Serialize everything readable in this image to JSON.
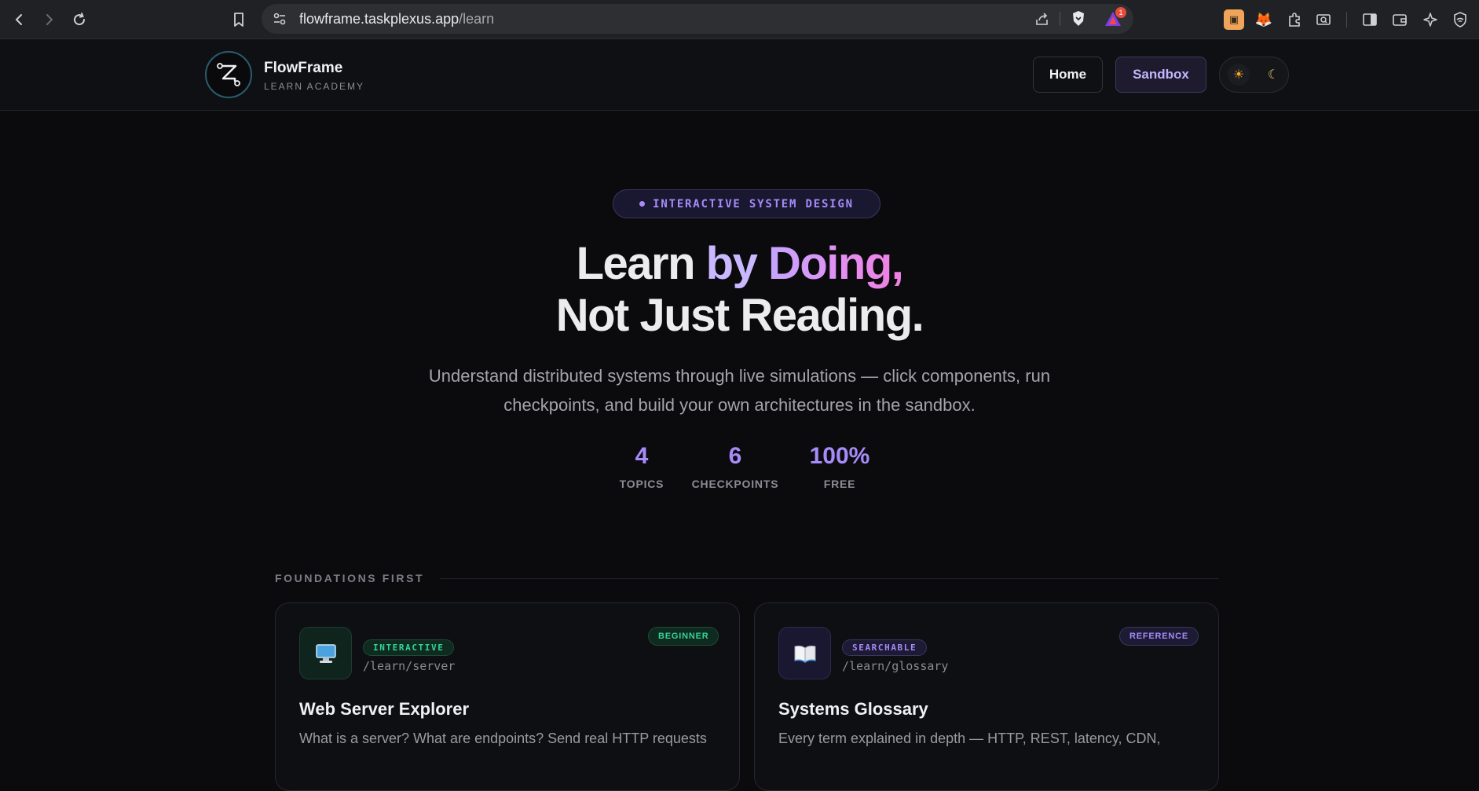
{
  "browser": {
    "url_host": "flowframe.taskplexus.app",
    "url_path": "/learn",
    "notification_count": "1"
  },
  "header": {
    "brand_name": "FlowFrame",
    "brand_sub": "LEARN ACADEMY",
    "nav": {
      "home": "Home",
      "sandbox": "Sandbox"
    },
    "theme": {
      "light_icon": "sun-icon",
      "dark_icon": "moon-icon"
    }
  },
  "hero": {
    "pill": "INTERACTIVE SYSTEM DESIGN",
    "title_line1_part1": "Learn ",
    "title_line1_part2": "by ",
    "title_line1_part3": "Doing,",
    "title_line2": "Not Just Reading.",
    "subtitle_line1": "Understand distributed systems through live simulations — click components, run",
    "subtitle_line2": "checkpoints, and build your own architectures in the sandbox.",
    "stats": [
      {
        "value": "4",
        "label": "TOPICS"
      },
      {
        "value": "6",
        "label": "CHECKPOINTS"
      },
      {
        "value": "100%",
        "label": "FREE"
      }
    ]
  },
  "section": {
    "title": "FOUNDATIONS FIRST",
    "cards": [
      {
        "icon": "monitor-icon",
        "tag": "INTERACTIVE",
        "route": "/learn/server",
        "level": "BEGINNER",
        "title": "Web Server Explorer",
        "desc": "What is a server? What are endpoints? Send real HTTP requests"
      },
      {
        "icon": "book-icon",
        "tag": "SEARCHABLE",
        "route": "/learn/glossary",
        "level": "REFERENCE",
        "title": "Systems Glossary",
        "desc": "Every term explained in depth — HTTP, REST, latency, CDN,"
      }
    ]
  },
  "colors": {
    "accent": "#a78bfa",
    "beginner_green": "#22c55e",
    "background": "#0b0b0d"
  }
}
